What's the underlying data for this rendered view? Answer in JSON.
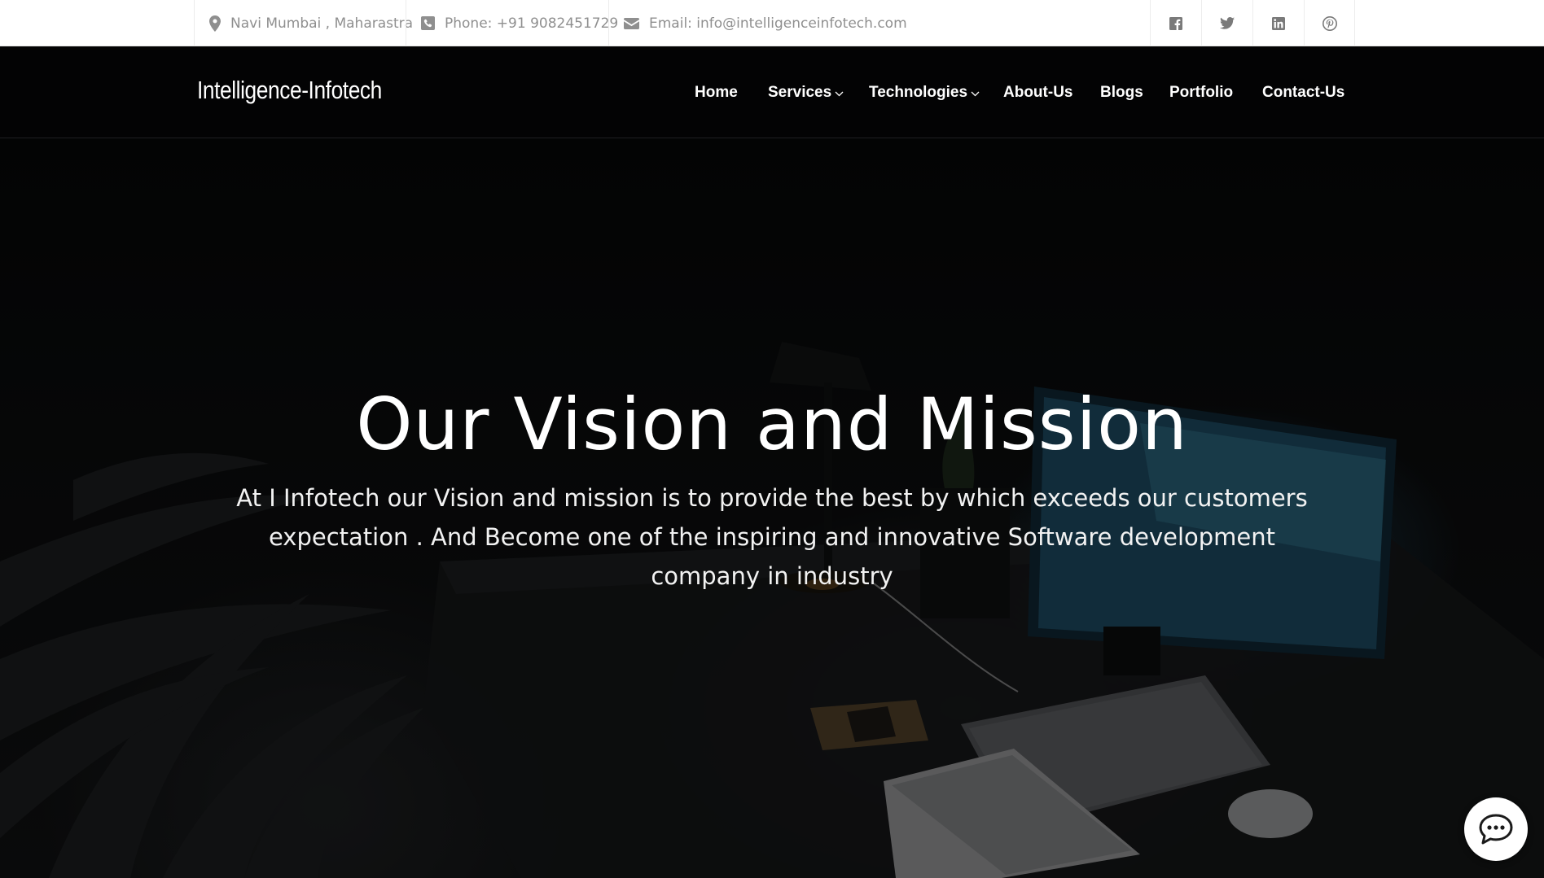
{
  "topbar": {
    "location": "Navi Mumbai , Maharastra",
    "phone": "Phone: +91 9082451729",
    "email": "Email: info@intelligenceinfotech.com",
    "location_icon": "map-pin-icon",
    "phone_icon": "phone-square-icon",
    "email_icon": "envelope-icon",
    "social": [
      "facebook-icon",
      "twitter-icon",
      "linkedin-icon",
      "pinterest-icon"
    ]
  },
  "header": {
    "logo": "Intelligence-Infotech",
    "nav": [
      {
        "label": "Home",
        "dropdown": false
      },
      {
        "label": "Services",
        "dropdown": true
      },
      {
        "label": "Technologies",
        "dropdown": true
      },
      {
        "label": "About-Us",
        "dropdown": false
      },
      {
        "label": "Blogs",
        "dropdown": false
      },
      {
        "label": "Portfolio",
        "dropdown": false
      },
      {
        "label": "Contact-Us",
        "dropdown": false
      }
    ]
  },
  "hero": {
    "title": "Our Vision and Mission",
    "text": "At I Infotech our Vision and mission is to provide the best by which exceeds our customers expectation . And Become one of the inspiring and innovative Software development company in industry"
  },
  "chat": {
    "icon": "chat-bubble-icon"
  },
  "colors": {
    "topbar_bg": "#ffffff",
    "topbar_text": "#8f8f8f",
    "header_bg": "#030304",
    "hero_text": "#ffffff"
  }
}
